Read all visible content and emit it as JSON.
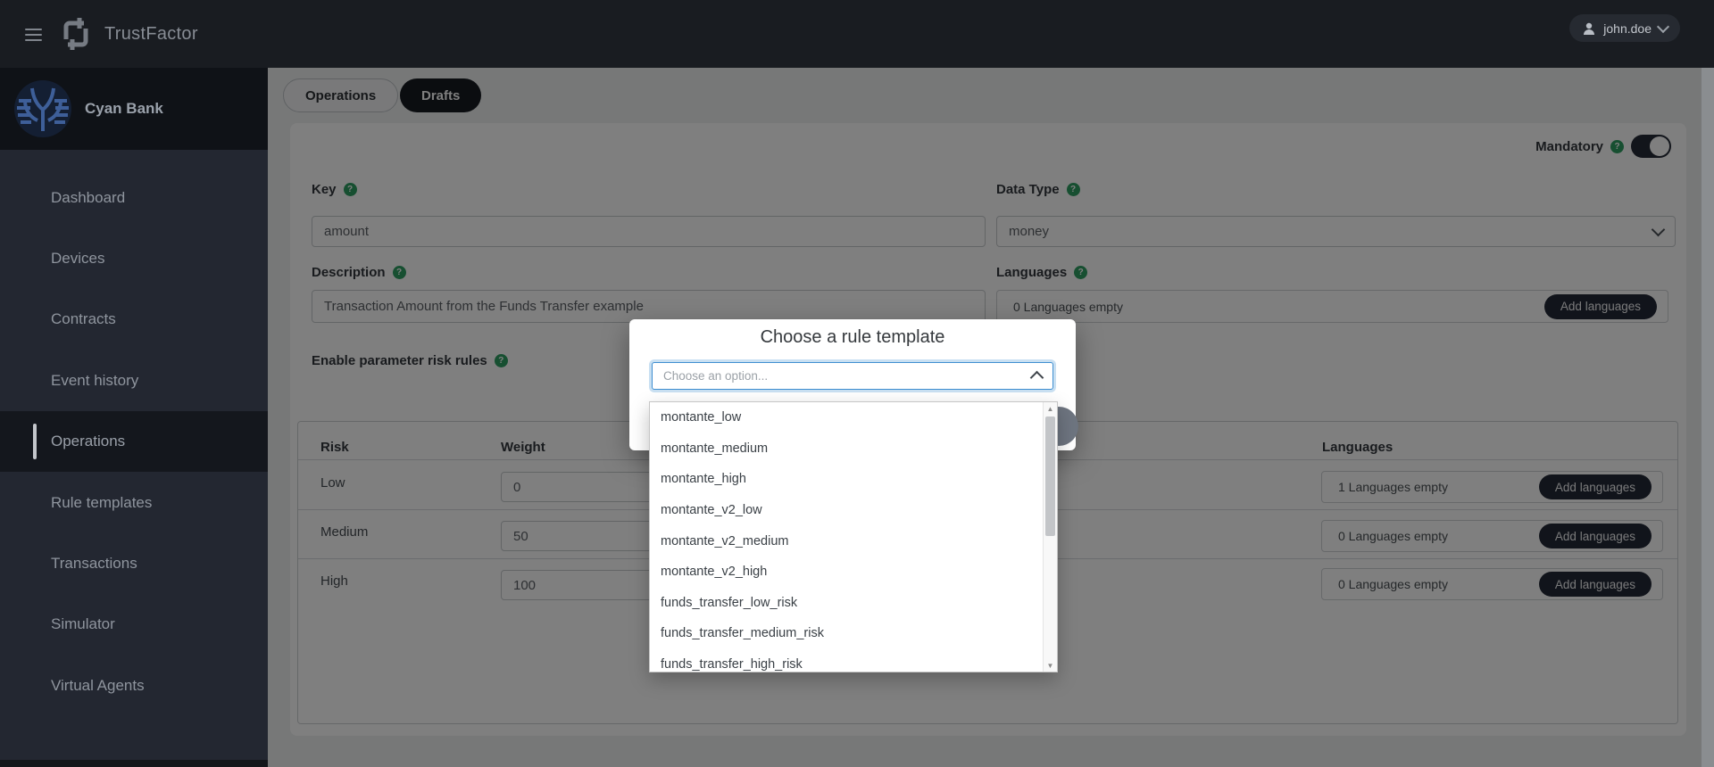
{
  "topbar": {
    "brand": "TrustFactor",
    "user": "john.doe"
  },
  "sidebar": {
    "org": "Cyan Bank",
    "items": [
      {
        "label": "Dashboard"
      },
      {
        "label": "Devices"
      },
      {
        "label": "Contracts"
      },
      {
        "label": "Event history"
      },
      {
        "label": "Operations"
      },
      {
        "label": "Rule templates"
      },
      {
        "label": "Transactions"
      },
      {
        "label": "Simulator"
      },
      {
        "label": "Virtual Agents"
      }
    ]
  },
  "tabs": {
    "operations": "Operations",
    "drafts": "Drafts"
  },
  "page": {
    "mandatory_label": "Mandatory",
    "key_label": "Key",
    "key_value": "amount",
    "data_type_label": "Data Type",
    "data_type_value": "money",
    "description_label": "Description",
    "description_value": "Transaction Amount from the Funds Transfer example",
    "languages_label": "Languages",
    "languages_status": "0 Languages empty",
    "add_languages_label": "Add languages",
    "enable_rules_label": "Enable parameter risk rules",
    "table": {
      "headers": {
        "risk": "Risk",
        "weight": "Weight",
        "languages": "Languages"
      },
      "rows": [
        {
          "risk": "Low",
          "weight": "0",
          "languages": "1 Languages empty",
          "button": "Add languages"
        },
        {
          "risk": "Medium",
          "weight": "50",
          "languages": "0 Languages empty",
          "button": "Add languages"
        },
        {
          "risk": "High",
          "weight": "100",
          "languages": "0 Languages empty",
          "button": "Add languages"
        }
      ]
    }
  },
  "modal": {
    "title": "Choose a rule template",
    "placeholder": "Choose an option...",
    "options": [
      "montante_low",
      "montante_medium",
      "montante_high",
      "montante_v2_low",
      "montante_v2_medium",
      "montante_v2_high",
      "funds_transfer_low_risk",
      "funds_transfer_medium_risk",
      "funds_transfer_high_risk"
    ]
  },
  "colors": {
    "accent_green": "#2f9e63",
    "dark_button": "#232936",
    "focus_blue": "#3e8ed0",
    "topbar_bg": "#191c21",
    "sidebar_bg": "#232731"
  }
}
